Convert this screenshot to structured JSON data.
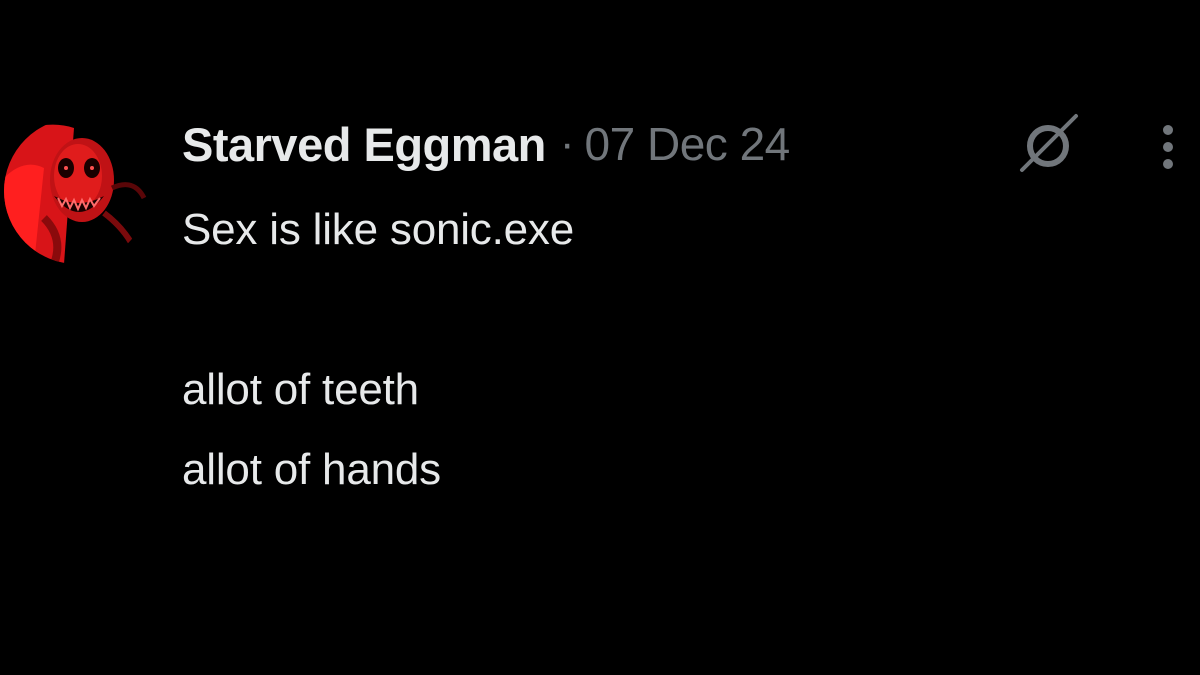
{
  "post": {
    "author": {
      "display_name": "Starved Eggman",
      "avatar_icon": "red-creepy-face-avatar"
    },
    "separator": "·",
    "timestamp": "07 Dec 24",
    "text_lines": [
      "Sex is like sonic.exe",
      "",
      "allot of teeth",
      "allot of hands"
    ],
    "actions": {
      "grok_icon": "grok-slash-icon",
      "more_icon": "more-vertical-icon"
    }
  },
  "colors": {
    "background": "#000000",
    "primary_text": "#e7e9ea",
    "secondary_text": "#71767b",
    "avatar_red": "#e0181c"
  }
}
